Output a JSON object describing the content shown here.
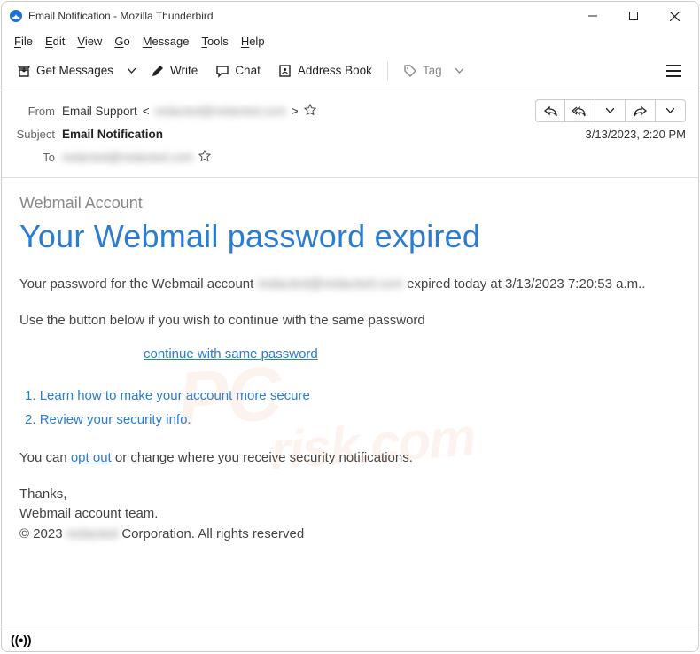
{
  "window": {
    "title": "Email Notification - Mozilla Thunderbird"
  },
  "menu": {
    "file": "File",
    "edit": "Edit",
    "view": "View",
    "go": "Go",
    "message": "Message",
    "tools": "Tools",
    "help": "Help"
  },
  "toolbar": {
    "get_messages": "Get Messages",
    "write": "Write",
    "chat": "Chat",
    "address_book": "Address Book",
    "tag": "Tag"
  },
  "header": {
    "from_label": "From",
    "from_name": "Email Support",
    "from_addr_open": " < ",
    "from_addr_masked": "redacted@redacted.com",
    "from_addr_close": " >",
    "subject_label": "Subject",
    "subject": "Email Notification",
    "to_label": "To",
    "to_masked": "redacted@redacted.com",
    "date": "3/13/2023, 2:20 PM"
  },
  "body": {
    "account_label": "Webmail Account",
    "title": "Your Webmail password expired",
    "p1_a": "Your password for the Webmail account  ",
    "p1_masked": "redacted@redacted.com",
    "p1_b": "  expired today at 3/13/2023 7:20:53 a.m..",
    "p2": "Use the button below  if you wish to continue with the same password",
    "cta": "continue with same password",
    "steps": [
      "Learn how to make your account more secure",
      "Review your security info."
    ],
    "p3_a": "You can ",
    "p3_link": "opt out",
    "p3_b": " or change where you receive security notifications.",
    "thanks": "Thanks,",
    "team": "Webmail account team.",
    "copyright_a": "© 2023 ",
    "copyright_masked": "redacted",
    "copyright_b": " Corporation. All rights reserved"
  },
  "watermark": {
    "line1": "PC",
    "line2": "risk.com"
  }
}
